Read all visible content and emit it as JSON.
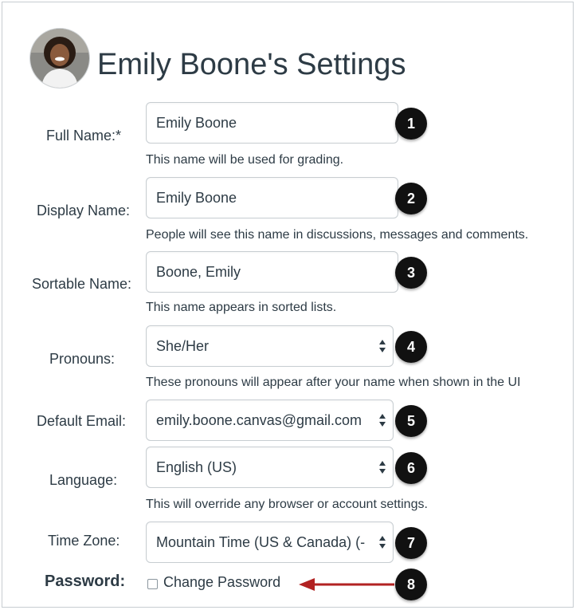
{
  "header": {
    "title": "Emily Boone's Settings"
  },
  "form": {
    "full_name": {
      "label": "Full Name:*",
      "value": "Emily Boone",
      "help": "This name will be used for grading.",
      "badge": "1"
    },
    "display_name": {
      "label": "Display Name:",
      "value": "Emily Boone",
      "help": "People will see this name in discussions, messages and comments.",
      "badge": "2"
    },
    "sortable_name": {
      "label": "Sortable Name:",
      "value": "Boone, Emily",
      "help": "This name appears in sorted lists.",
      "badge": "3"
    },
    "pronouns": {
      "label": "Pronouns:",
      "value": "She/Her",
      "help": "These pronouns will appear after your name when shown in the UI",
      "badge": "4"
    },
    "default_email": {
      "label": "Default Email:",
      "value": "emily.boone.canvas@gmail.com",
      "badge": "5"
    },
    "language": {
      "label": "Language:",
      "value": "English (US)",
      "help": "This will override any browser or account settings.",
      "badge": "6"
    },
    "time_zone": {
      "label": "Time Zone:",
      "value": "Mountain Time (US & Canada) (-",
      "badge": "7"
    },
    "password": {
      "label": "Password:",
      "checkbox_label": "Change Password",
      "checked": false,
      "badge": "8"
    }
  },
  "colors": {
    "badge": "#111111",
    "arrow": "#b22222",
    "text": "#2d3b45",
    "border": "#c7cdd1"
  },
  "icons": {
    "select_arrows": "up-down-chevron-icon",
    "annotation_arrow": "left-arrow-icon"
  }
}
